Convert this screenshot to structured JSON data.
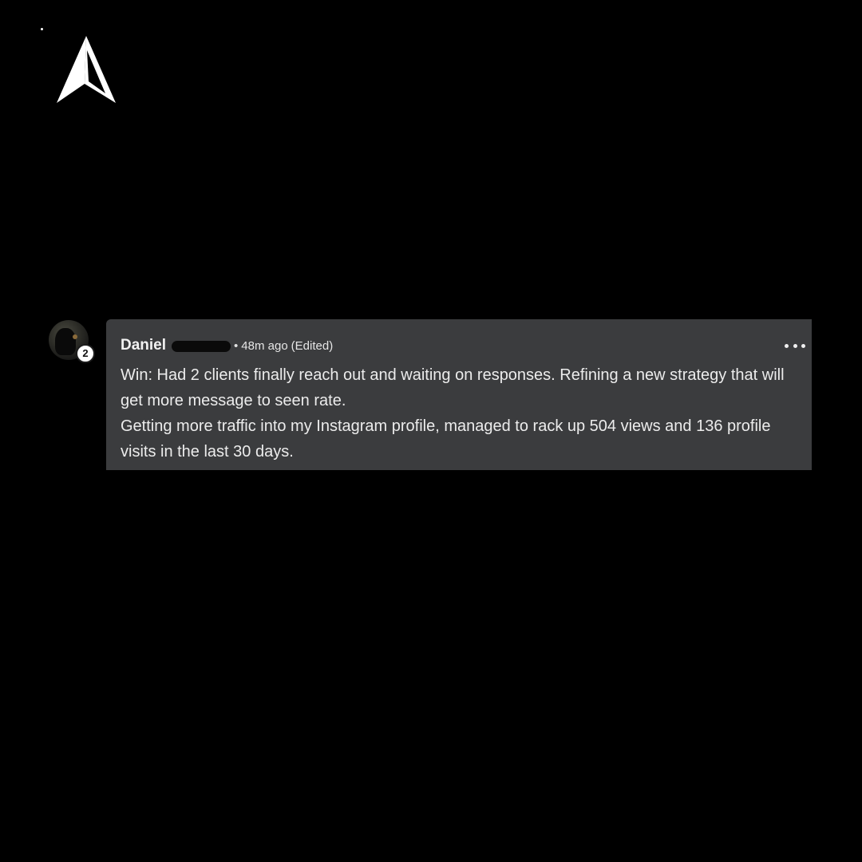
{
  "logo": {
    "icon": "arrow-pointer-logo",
    "color": "#ffffff"
  },
  "post": {
    "author_name": "Daniel",
    "level": "2",
    "separator": "•",
    "time": "48m ago",
    "edited": "(Edited)",
    "more_icon": "more-horizontal-icon",
    "body": [
      "Win: Had 2 clients finally reach out and waiting on responses. Refining a new strategy that will get more message to seen rate.",
      "Getting more traffic into my Instagram profile, managed to rack up 504 views and 136 profile visits in the last 30 days."
    ]
  },
  "colors": {
    "background": "#000000",
    "card": "#3b3c3e",
    "text": "#ececec"
  }
}
